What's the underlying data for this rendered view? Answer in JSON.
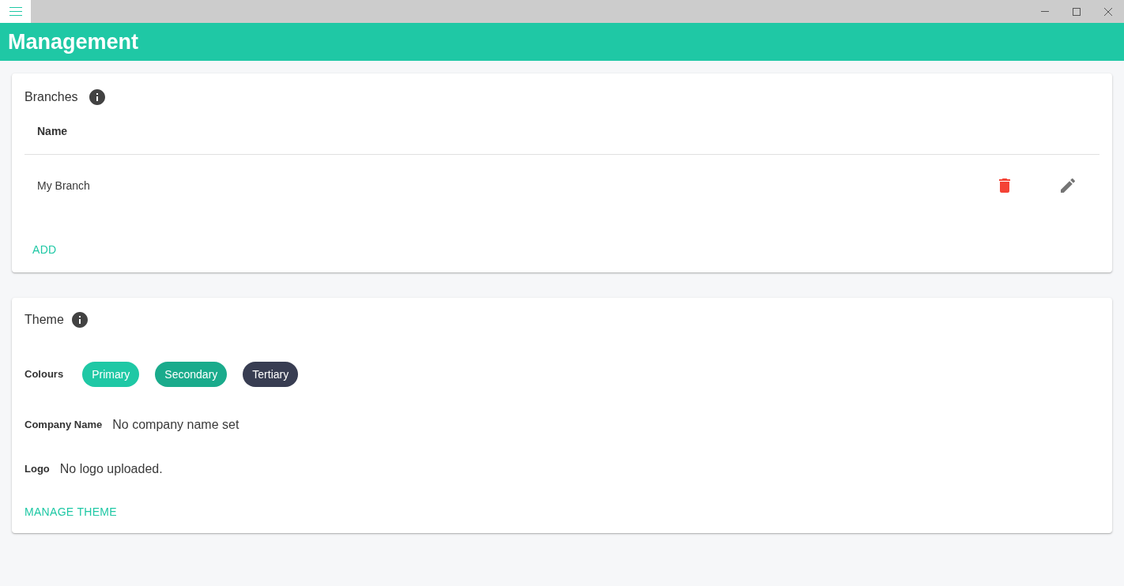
{
  "header": {
    "title": "Management"
  },
  "branches": {
    "title": "Branches",
    "columns": [
      "Name"
    ],
    "rows": [
      {
        "name": "My Branch"
      }
    ],
    "add_button": "ADD"
  },
  "theme": {
    "title": "Theme",
    "colours": {
      "label": "Colours",
      "chips": [
        {
          "label": "Primary",
          "color": "#1fc8a5"
        },
        {
          "label": "Secondary",
          "color": "#1aab8c"
        },
        {
          "label": "Tertiary",
          "color": "#383d52"
        }
      ]
    },
    "company_name": {
      "label": "Company Name",
      "value": "No company name set"
    },
    "logo": {
      "label": "Logo",
      "value": "No logo uploaded."
    },
    "manage_button": "MANAGE THEME"
  }
}
